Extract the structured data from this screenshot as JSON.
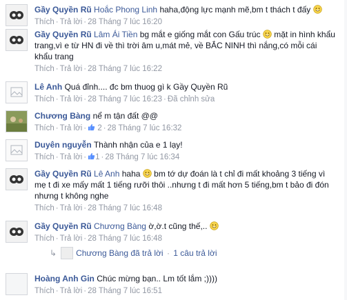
{
  "comments": [
    {
      "author": "Gầy Quyền Rũ",
      "mention": "Hoắc Phong Linh",
      "text": "haha,động lực mạnh mẽ,bm t thách t đấy",
      "emoji": "grin-emoji",
      "like": "Thích",
      "reply": "Trả lời",
      "time": "28 Tháng 7 lúc 16:20"
    },
    {
      "author": "Gầy Quyền Rũ",
      "mention": "Lâm Ái Tiền",
      "text1": "bg mắt e giống mắt con Gấu trúc",
      "text2": "mặt in hình khẩu",
      "text3": "trang,vì e từ HN đi về thì trời âm u,mát mẻ, về BẮC NINH thì nắng,có mỗi cái",
      "text4": "khẩu trang",
      "like": "Thích",
      "reply": "Trả lời",
      "time": "28 Tháng 7 lúc 16:22"
    },
    {
      "author": "Lê Anh",
      "text": "Quá đỉnh.... đc bm thuog gì k Gầy Quyền Rũ",
      "like": "Thích",
      "reply": "Trả lời",
      "time": "28 Tháng 7 lúc 16:23",
      "edited": "Đã chỉnh sửa"
    },
    {
      "author": "Chương Bàng",
      "text": "nể m tận đất @@",
      "like": "Thích",
      "reply": "Trả lời",
      "likes": "2",
      "time": "28 Tháng 7 lúc 16:32"
    },
    {
      "author": "Duyên nguyễn",
      "text": "Thành nhận của e 1 lạy!",
      "like": "Thích",
      "reply": "Trả lời",
      "likes": "1",
      "time": "28 Tháng 7 lúc 16:34"
    },
    {
      "author": "Gầy Quyền Rũ",
      "mention": "Lê Anh",
      "text1": "haha",
      "text2": "bm tớ dự đoán là t chỉ đi mất khoảng 3 tiếng vì",
      "text3": "mẹ t đi xe mấy mất 1 tiếng rưỡi thôi ..nhưng t đi mất hơn 5 tiếng,bm t bảo đi đón",
      "text4": "nhưng t không nghe",
      "like": "Thích",
      "reply": "Trả lời",
      "time": "28 Tháng 7 lúc 16:48"
    },
    {
      "author": "Gầy Quyền Rũ",
      "mention": "Chương Bàng",
      "text": "ờ,ờ.t cũng thế,..",
      "like": "Thích",
      "reply": "Trả lời",
      "time": "28 Tháng 7 lúc 16:48"
    },
    {
      "author": "Hoàng Anh Gin",
      "text": "Chúc mừng bạn.. Lm tốt lắm ;))))",
      "like": "Thích",
      "reply": "Trả lời",
      "time": "28 Tháng 7 lúc 16:51"
    }
  ],
  "reply_summary": {
    "replier": "Chương Bàng",
    "action": "đã trả lời",
    "count": "1 câu trả lời"
  },
  "colors": {
    "link": "#3b5998",
    "meta": "#9197a3",
    "text": "#141823"
  }
}
